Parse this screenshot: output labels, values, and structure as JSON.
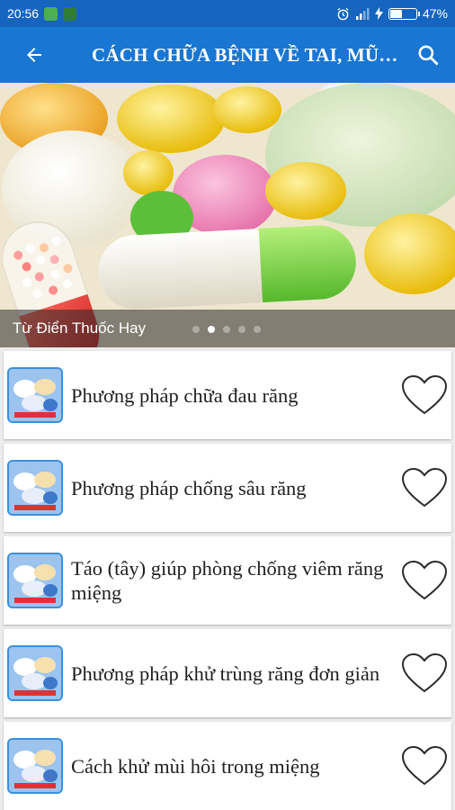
{
  "status_bar": {
    "time": "20:56",
    "battery_percent": "47%",
    "battery_level": 0.47,
    "icons": [
      "notification-icon",
      "notification-icon",
      "alarm-icon",
      "signal-icon",
      "charging-icon",
      "battery-icon"
    ]
  },
  "app_bar": {
    "title": "CÁCH CHỮA BỆNH VỀ TAI, MŨI, HỌNG, RĂNG MIỆNG",
    "back_icon": "arrow-left-icon",
    "search_icon": "search-icon"
  },
  "banner": {
    "caption": "Từ Điển Thuốc Hay",
    "slide_count": 5,
    "active_slide": 1
  },
  "list": {
    "items": [
      {
        "title": "Phương pháp chữa đau răng"
      },
      {
        "title": "Phương pháp chống sâu răng"
      },
      {
        "title": "Táo (tây) giúp phòng chống viêm răng miệng"
      },
      {
        "title": "Phương pháp khử trùng răng đơn giản"
      },
      {
        "title": "Cách khử mùi hôi trong miệng"
      }
    ]
  },
  "colors": {
    "status_bar": "#1565c0",
    "app_bar": "#1976d2",
    "background": "#ececec"
  }
}
